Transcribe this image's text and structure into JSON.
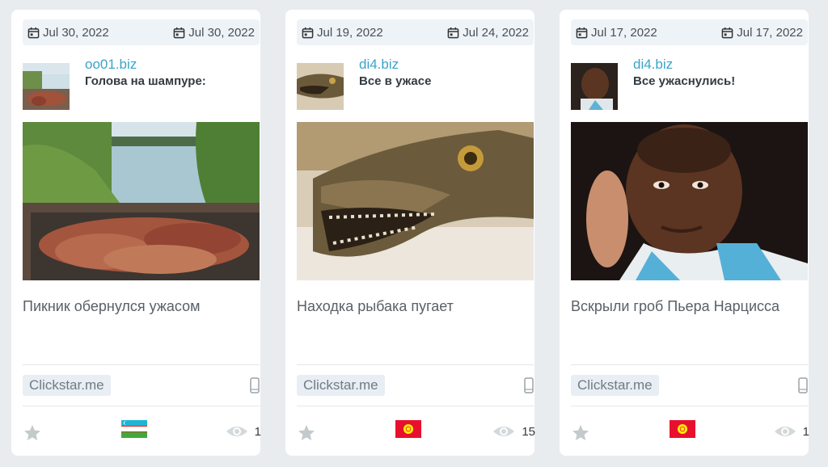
{
  "cards": [
    {
      "date_start": "Jul 30, 2022",
      "date_end": "Jul 30, 2022",
      "source": "oo01.biz",
      "subtitle": "Голова на шампуре:",
      "headline": "Пикник обернулся ужасом",
      "ad_network": "Clickstar.me",
      "country_flag": "uzbekistan",
      "views": "1"
    },
    {
      "date_start": "Jul 19, 2022",
      "date_end": "Jul 24, 2022",
      "source": "di4.biz",
      "subtitle": "Все в ужасе",
      "headline": "Находка рыбака пугает",
      "ad_network": "Clickstar.me",
      "country_flag": "kyrgyzstan",
      "views": "15"
    },
    {
      "date_start": "Jul 17, 2022",
      "date_end": "Jul 17, 2022",
      "source": "di4.biz",
      "subtitle": "Все ужаснулись!",
      "headline": "Вскрыли гроб Пьера Нарцисса",
      "ad_network": "Clickstar.me",
      "country_flag": "kyrgyzstan",
      "views": "1"
    }
  ],
  "colors": {
    "accent": "#3aa4c9",
    "date_bar": "#eef3f7",
    "badge_bg": "#e8eef3"
  },
  "icons": [
    "calendar-icon",
    "star-icon",
    "eye-icon",
    "mobile-phone-icon"
  ]
}
